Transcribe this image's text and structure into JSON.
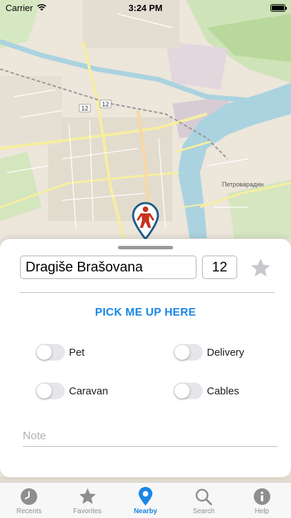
{
  "status_bar": {
    "carrier": "Carrier",
    "time": "3:24 PM",
    "wifi_icon": "wifi-icon",
    "battery_icon": "battery-icon",
    "battery_level": 1.0
  },
  "map": {
    "labels": [
      "12",
      "12",
      "Петроварадин"
    ],
    "pin_icon": "person-location-pin-icon",
    "pin_color": "#c8321e",
    "pin_outline_color": "#1d5a8c"
  },
  "address": {
    "street": "Dragiše Brašovana",
    "number": "12",
    "favorite_icon": "star-icon"
  },
  "pickup_button": "PICK ME UP HERE",
  "options": [
    {
      "label": "Pet",
      "on": false
    },
    {
      "label": "Delivery",
      "on": false
    },
    {
      "label": "Caravan",
      "on": false
    },
    {
      "label": "Cables",
      "on": false
    }
  ],
  "note": {
    "placeholder": "Note"
  },
  "tabs": [
    {
      "label": "Recents",
      "icon": "clock-icon",
      "active": false
    },
    {
      "label": "Favorites",
      "icon": "star-icon",
      "active": false
    },
    {
      "label": "Nearby",
      "icon": "location-pin-icon",
      "active": true
    },
    {
      "label": "Search",
      "icon": "magnifier-icon",
      "active": false
    },
    {
      "label": "Help",
      "icon": "info-icon",
      "active": false
    }
  ],
  "colors": {
    "accent": "#1a86e6",
    "inactive": "#8e8e8e",
    "river": "#aad3df",
    "park": "#c8dfb0"
  }
}
